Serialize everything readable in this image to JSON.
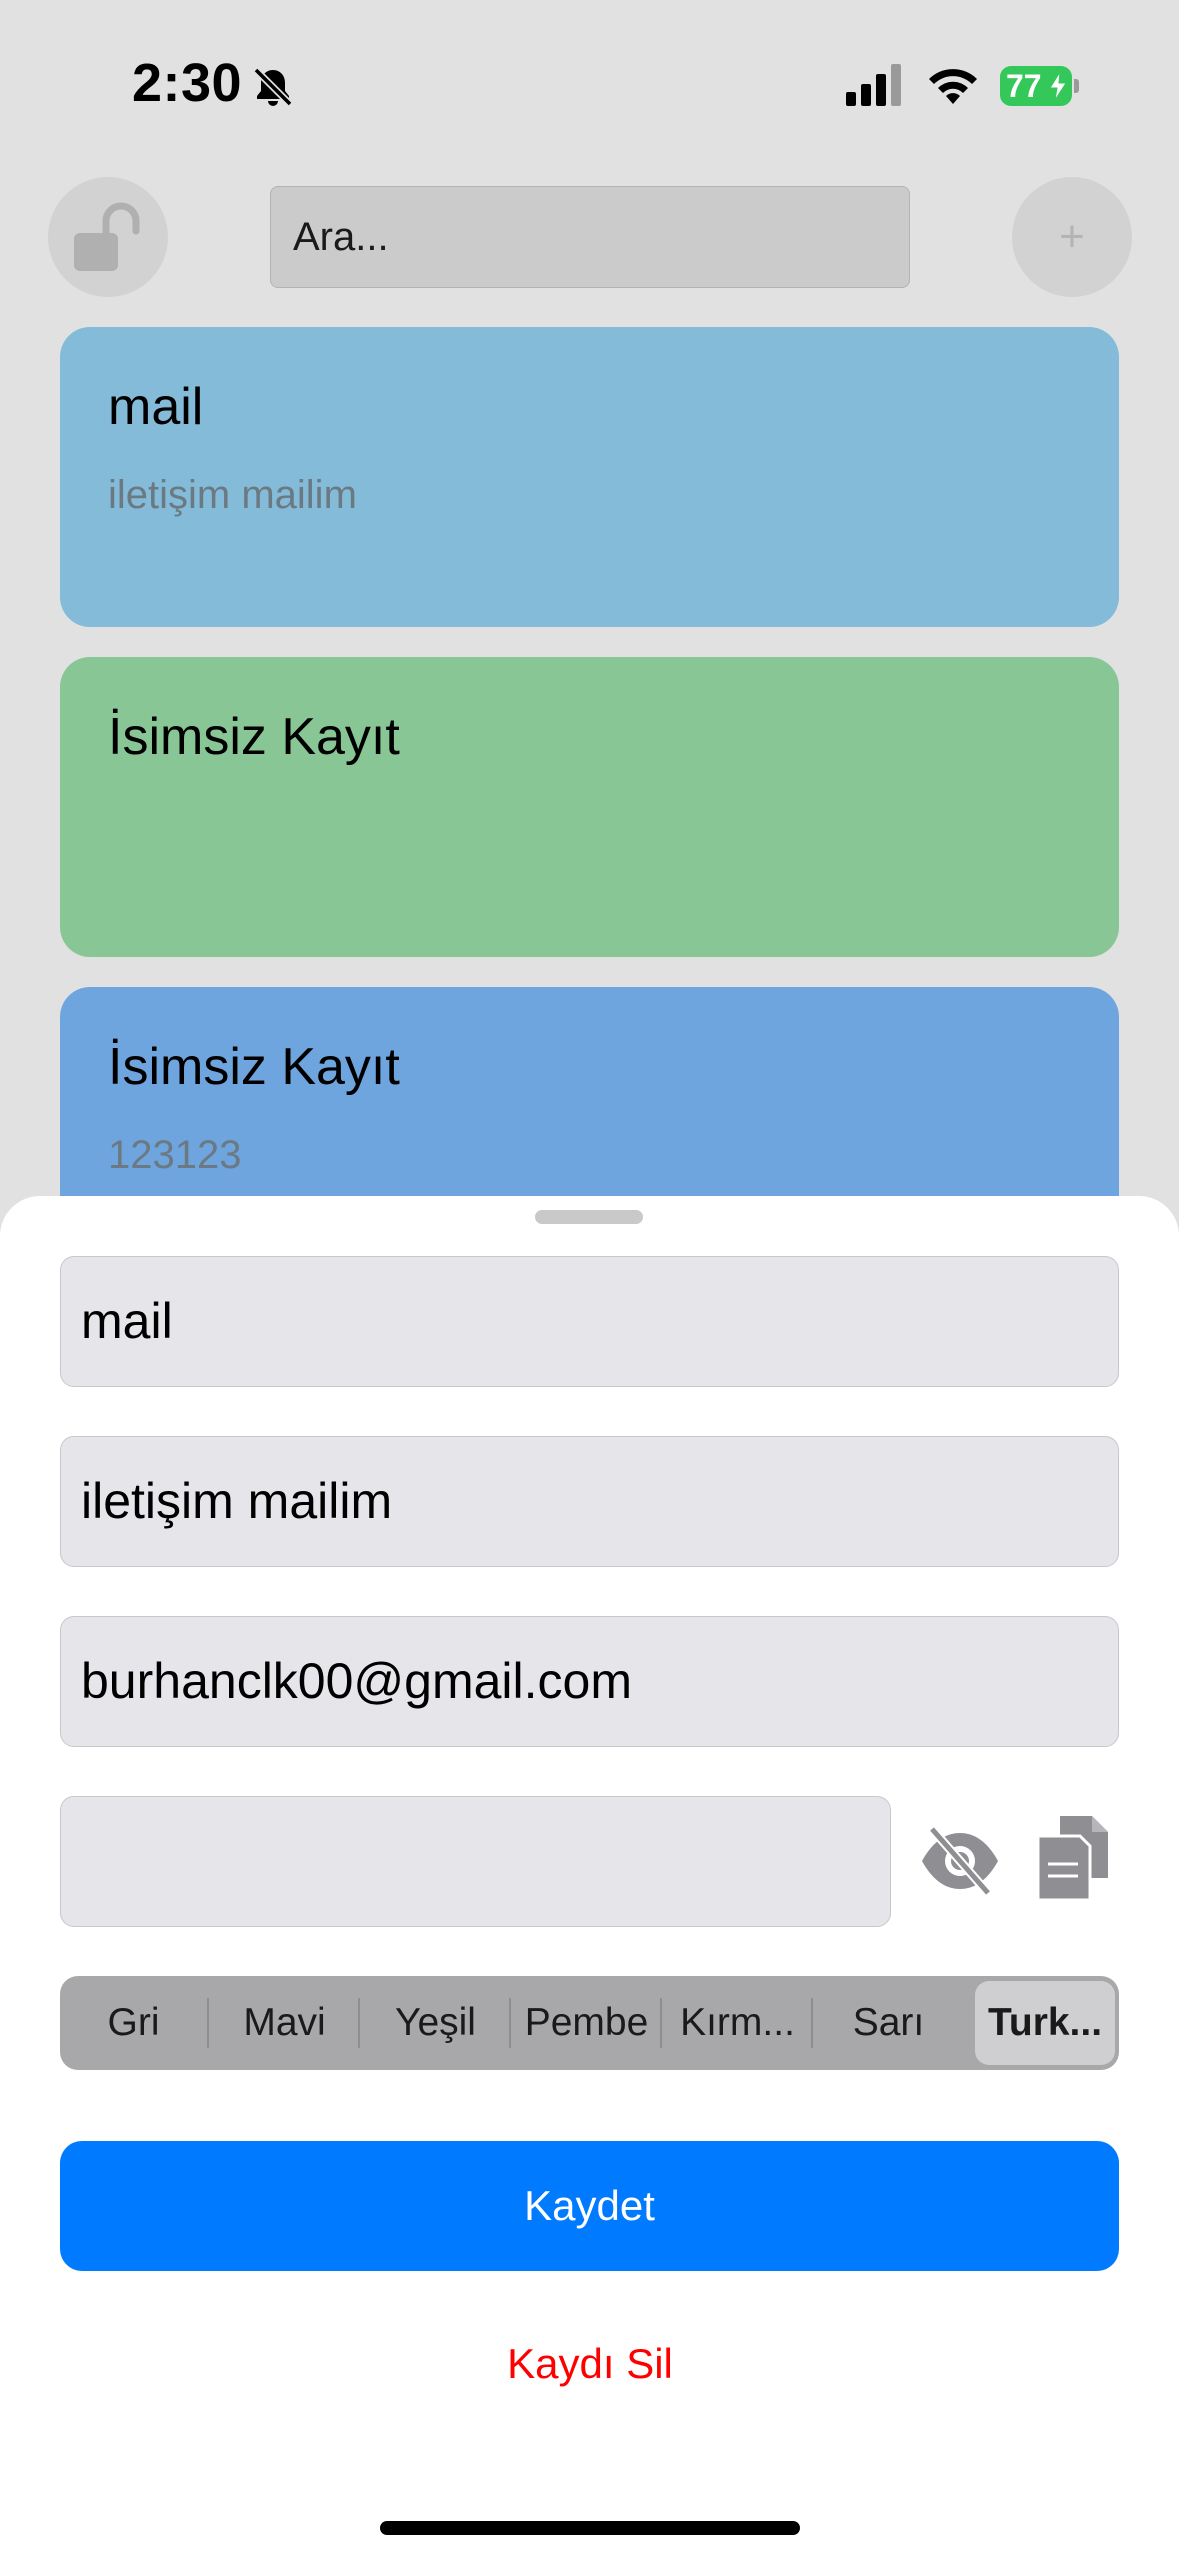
{
  "status_bar": {
    "time": "2:30",
    "battery_level": "77",
    "icons": [
      "bell-slash-icon",
      "cellular-signal-icon",
      "wifi-icon",
      "battery-charging-icon"
    ]
  },
  "toolbar": {
    "lock_icon": "lock-open-icon",
    "search_placeholder": "Ara...",
    "add_icon": "plus-icon"
  },
  "records": [
    {
      "title": "mail",
      "subtitle": "iletişim mailim",
      "color": "#84bbd8"
    },
    {
      "title": "İsimsiz Kayıt",
      "subtitle": "",
      "color": "#88c795"
    },
    {
      "title": "İsimsiz Kayıt",
      "subtitle": "123123",
      "color": "#6fa5df"
    }
  ],
  "editor": {
    "title_value": "mail",
    "description_value": "iletişim mailim",
    "username_value": "burhanclk00@gmail.com",
    "password_value": "",
    "reveal_icon": "eye-slash-icon",
    "copy_icon": "copy-icon",
    "colors": [
      "Gri",
      "Mavi",
      "Yeşil",
      "Pembe",
      "Kırm...",
      "Sarı",
      "Turk..."
    ],
    "selected_color": "Turk...",
    "save_label": "Kaydet",
    "delete_label": "Kaydı Sil",
    "accent_color": "#007aff",
    "destructive_color": "#ff0000"
  }
}
